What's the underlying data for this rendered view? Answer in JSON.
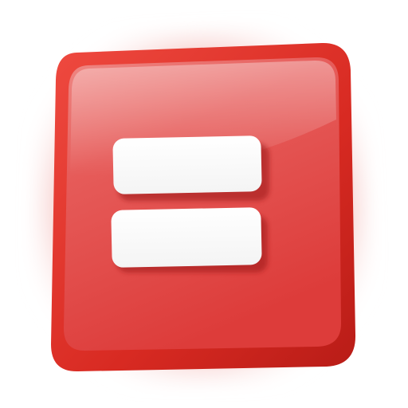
{
  "icon": {
    "name": "equals-icon",
    "colors": {
      "outer_glow": "#f3b8b8",
      "frame_dark": "#c8221e",
      "frame_mid": "#e23a33",
      "face_light": "#ec6f6f",
      "face_main": "#e64a4a",
      "face_dark": "#d93434",
      "bar_fill": "#ffffff",
      "bar_shadow": "#9a1414"
    }
  }
}
